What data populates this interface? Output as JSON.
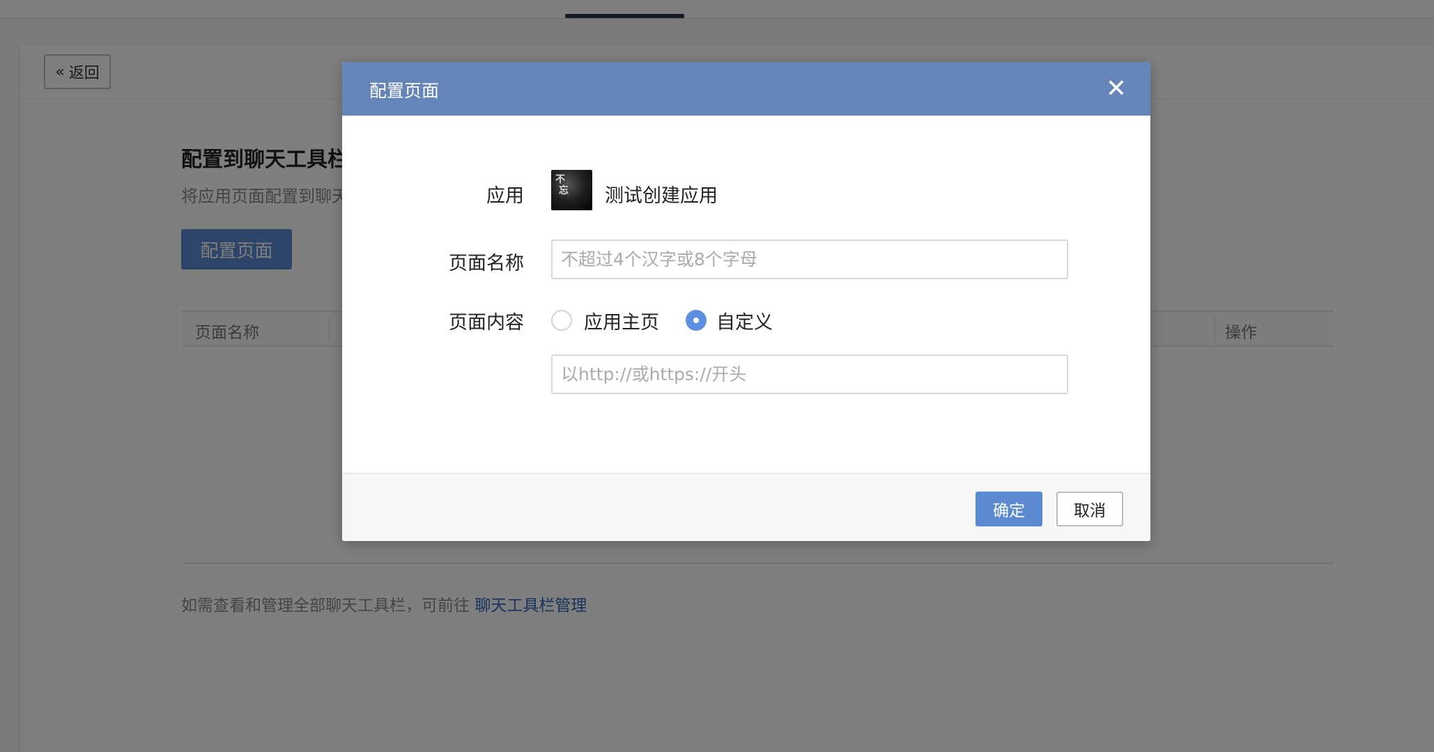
{
  "background": {
    "back_button_label": "返回",
    "section_title": "配置到聊天工具栏",
    "section_desc": "将应用页面配置到聊天",
    "config_button_label": "配置页面",
    "table_headers": [
      "页面名称",
      "操作"
    ],
    "footer_text": "如需查看和管理全部聊天工具栏，可前往",
    "footer_link": "聊天工具栏管理"
  },
  "modal": {
    "title": "配置页面",
    "close_icon": "close-icon",
    "app_label": "应用",
    "app_name": "测试创建应用",
    "page_name_label": "页面名称",
    "page_name_placeholder": "不超过4个汉字或8个字母",
    "page_content_label": "页面内容",
    "radio_options": [
      "应用主页",
      "自定义"
    ],
    "selected_option": "自定义",
    "url_placeholder": "以http://或https://开头",
    "confirm_label": "确定",
    "cancel_label": "取消"
  },
  "colors": {
    "header_bg": "#6584b8",
    "primary_button": "#5b8ad2",
    "radio_checked": "#5d8fe0",
    "link": "#2f66b8"
  }
}
